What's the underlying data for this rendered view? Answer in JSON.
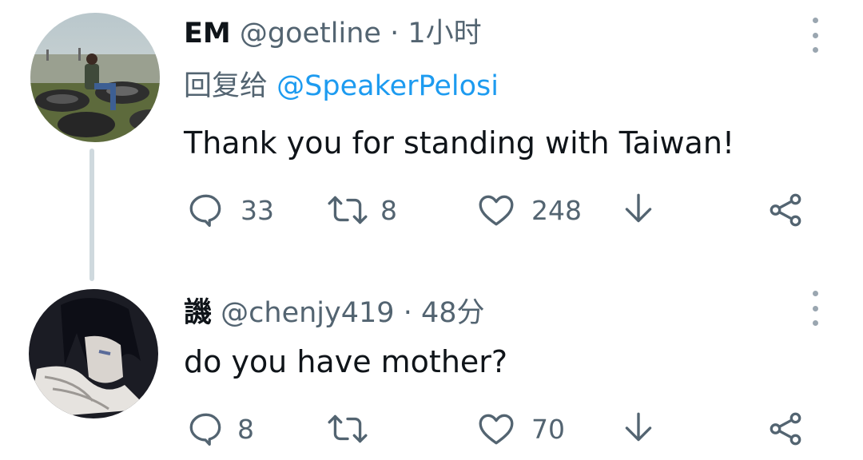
{
  "tweets": [
    {
      "name": "EM",
      "handle": "@goetline",
      "separator": "·",
      "time": "1小时",
      "reply_prefix": "回复给",
      "reply_to": "@SpeakerPelosi",
      "text": "Thank you for standing with Taiwan!",
      "replies": "33",
      "retweets": "8",
      "likes": "248"
    },
    {
      "name": "譏",
      "handle": "@chenjy419",
      "separator": "·",
      "time": "48分",
      "text": "do you have mother?",
      "replies": "8",
      "retweets": "",
      "likes": "70"
    }
  ],
  "icons": [
    "reply-icon",
    "retweet-icon",
    "like-icon",
    "share-download-icon",
    "share-icon",
    "more-options-icon"
  ],
  "colors": {
    "text": "#0f1419",
    "secondary": "#536471",
    "link": "#1d9bf0",
    "thread_line": "#cfd9de"
  }
}
